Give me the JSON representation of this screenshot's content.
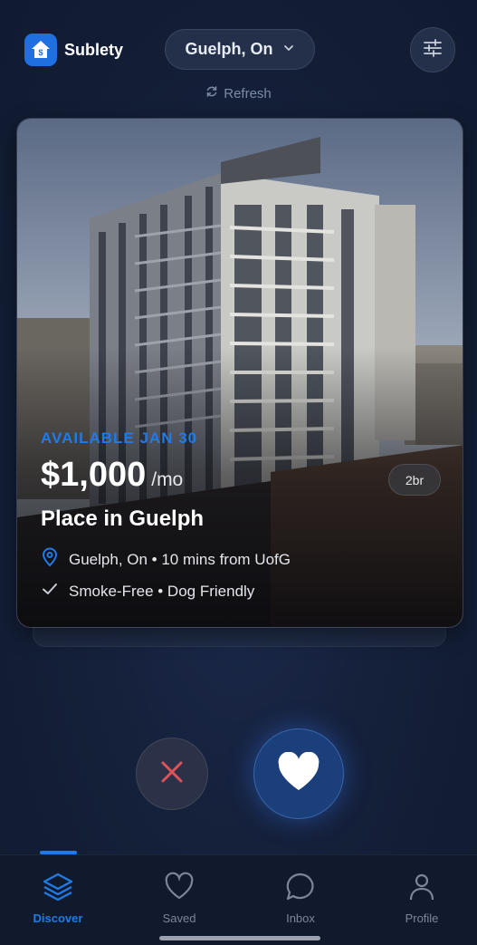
{
  "app": {
    "name": "Sublety",
    "location": "Guelph, On",
    "refresh_label": "Refresh"
  },
  "listing": {
    "availability": "AVAILABLE JAN 30",
    "price": "$1,000",
    "period": "/mo",
    "bedrooms": "2br",
    "title": "Place in Guelph",
    "location_line": "Guelph, On • 10 mins from UofG",
    "features_line": "Smoke-Free • Dog Friendly"
  },
  "nav": {
    "items": [
      {
        "label": "Discover",
        "icon": "layers-icon",
        "active": true
      },
      {
        "label": "Saved",
        "icon": "heart-outline-icon",
        "active": false
      },
      {
        "label": "Inbox",
        "icon": "chat-bubble-icon",
        "active": false
      },
      {
        "label": "Profile",
        "icon": "person-icon",
        "active": false
      }
    ]
  },
  "colors": {
    "accent": "#1f7be8",
    "dislike": "#e0525a",
    "background": "#15203a"
  }
}
